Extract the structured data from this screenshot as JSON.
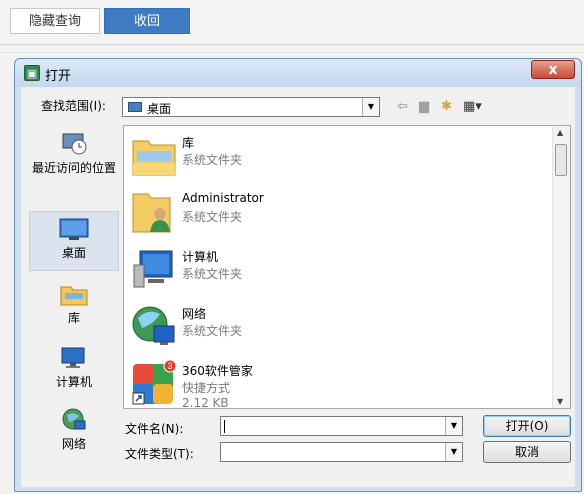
{
  "toolbar": {
    "hide_query_label": "隐藏查询",
    "collapse_label": "收回",
    "accent_color": "#3f7bc2"
  },
  "dialog": {
    "title": "打开",
    "close_label": "x",
    "look_in_label": "查找范围(I):",
    "look_in_value": "桌面",
    "nav_icons": [
      "back-arrow-icon",
      "up-folder-icon",
      "new-folder-icon",
      "view-menu-icon"
    ],
    "places": [
      {
        "label": "最近访问的位置",
        "icon": "recent-places-icon"
      },
      {
        "label": "桌面",
        "icon": "desktop-icon",
        "active": true
      },
      {
        "label": "库",
        "icon": "libraries-icon"
      },
      {
        "label": "计算机",
        "icon": "computer-icon"
      },
      {
        "label": "网络",
        "icon": "network-icon"
      }
    ],
    "files": [
      {
        "name": "库",
        "type": "系统文件夹",
        "icon": "libraries-folder-icon"
      },
      {
        "name": "Administrator",
        "type": "系统文件夹",
        "icon": "user-folder-icon"
      },
      {
        "name": "计算机",
        "type": "系统文件夹",
        "icon": "computer-icon"
      },
      {
        "name": "网络",
        "type": "系统文件夹",
        "icon": "network-globe-icon"
      },
      {
        "name": "360软件管家",
        "type": "快捷方式",
        "size": "2.12 KB",
        "icon": "app-shortcut-icon",
        "badge": "3"
      }
    ],
    "filename_label": "文件名(N):",
    "filename_value": "",
    "filetype_label": "文件类型(T):",
    "filetype_value": "",
    "open_label": "打开(O)",
    "cancel_label": "取消"
  }
}
